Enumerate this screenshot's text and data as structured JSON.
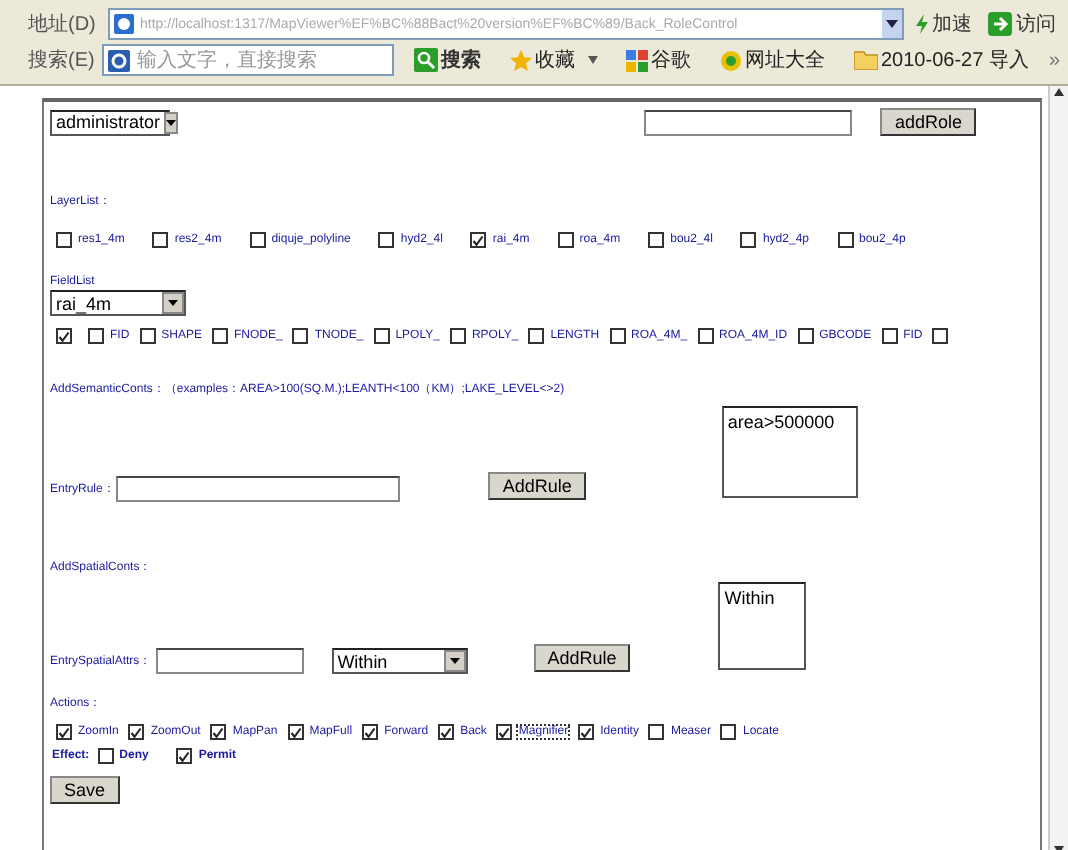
{
  "address_bar": {
    "label": "地址(D)",
    "url": "http://localhost:1317/MapViewer%EF%BC%88Bact%20version%EF%BC%89/Back_RoleControl",
    "buttons": [
      "加速",
      "访问"
    ]
  },
  "search_bar": {
    "label": "搜索(E)",
    "placeholder": "输入文字，直接搜索",
    "search_button": "搜索",
    "links": [
      "收藏",
      "谷歌",
      "网址大全",
      "2010-06-27 导入"
    ],
    "more": "»"
  },
  "role": {
    "selected": "administrator",
    "add_button": "addRole"
  },
  "layer_list": {
    "label": "LayerList：",
    "layers": [
      {
        "label": "res1_4m",
        "checked": false
      },
      {
        "label": "res2_4m",
        "checked": false
      },
      {
        "label": "diquje_polyline",
        "checked": false
      },
      {
        "label": "hyd2_4l",
        "checked": false
      },
      {
        "label": "rai_4m",
        "checked": true
      },
      {
        "label": "roa_4m",
        "checked": false
      },
      {
        "label": "bou2_4l",
        "checked": false
      },
      {
        "label": "hyd2_4p",
        "checked": false
      },
      {
        "label": "bou2_4p",
        "checked": false
      }
    ]
  },
  "field_list": {
    "label": "FieldList",
    "layer": "rai_4m",
    "fields": [
      {
        "checked": true
      },
      {
        "label": "FID",
        "checked": false
      },
      {
        "label": "SHAPE",
        "checked": false
      },
      {
        "label": "FNODE_",
        "checked": false
      },
      {
        "label": "TNODE_",
        "checked": false
      },
      {
        "label": "LPOLY_",
        "checked": false
      },
      {
        "label": "RPOLY_",
        "checked": false
      },
      {
        "label": "LENGTH",
        "checked": false
      },
      {
        "label": "ROA_4M_",
        "checked": false
      },
      {
        "label": "ROA_4M_ID",
        "checked": false
      },
      {
        "label": "GBCODE",
        "checked": false
      },
      {
        "label": "FID",
        "checked": false
      },
      {
        "checked": false
      }
    ]
  },
  "semantic": {
    "label": "AddSemanticConts：（examples：AREA>100(SQ.M.);LEANTH<100（KM）;LAKE_LEVEL<>2)",
    "entry_label": "EntryRule：",
    "button": "AddRule",
    "rules": [
      "area>500000"
    ]
  },
  "spatial": {
    "label": "AddSpatialConts：",
    "entry_label": "EntrySpatialAttrs：",
    "operator": "Within",
    "button": "AddRule",
    "rules": [
      "Within"
    ]
  },
  "actions": {
    "label": "Actions：",
    "items": [
      {
        "label": "ZoomIn",
        "checked": true,
        "focused": false
      },
      {
        "label": "ZoomOut",
        "checked": true,
        "focused": false
      },
      {
        "label": "MapPan",
        "checked": true,
        "focused": false
      },
      {
        "label": "MapFull",
        "checked": true,
        "focused": false
      },
      {
        "label": "Forward",
        "checked": true,
        "focused": false
      },
      {
        "label": "Back",
        "checked": true,
        "focused": false
      },
      {
        "label": "Magnifier",
        "checked": true,
        "focused": true
      },
      {
        "label": "Identity",
        "checked": true,
        "focused": false
      },
      {
        "label": "Measer",
        "checked": false,
        "focused": false
      },
      {
        "label": "Locate",
        "checked": false,
        "focused": false
      }
    ]
  },
  "effect": {
    "label": "Effect:",
    "options": [
      {
        "label": "Deny",
        "checked": false
      },
      {
        "label": "Permit",
        "checked": true
      }
    ]
  },
  "save_button": "Save"
}
